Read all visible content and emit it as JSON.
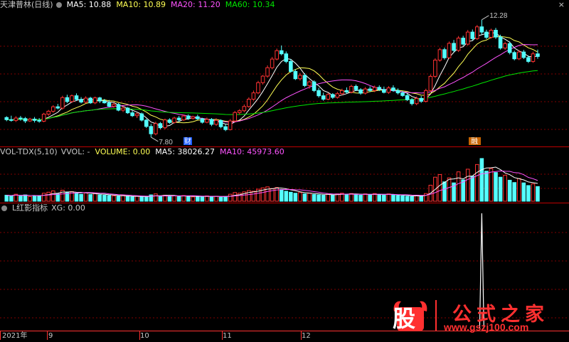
{
  "price_header": {
    "stock": "天津普林(日线)",
    "ma5": "MA5: 10.88",
    "ma10": "MA10: 10.89",
    "ma20": "MA20: 11.20",
    "ma60": "MA60: 10.34"
  },
  "volume_header": {
    "name": "VOL-TDX(5,10)",
    "vvol": "VVOL: -",
    "volume": "VOLUME: 0.00",
    "ma5": "MA5: 38026.27",
    "ma10": "MA10: 45973.60"
  },
  "indicator_header": {
    "name": "L红影指标",
    "xg": "XG: 0.00"
  },
  "annotations": {
    "high": "12.28",
    "low": "7.80",
    "tag_cai": "财",
    "tag_rong": "融"
  },
  "time_axis": [
    "2021年",
    "9",
    "10",
    "11",
    "12"
  ],
  "close_glyph": "×",
  "watermark": {
    "badge": "股",
    "title": "公式之家",
    "url": "www.gszj100.com"
  },
  "colors": {
    "up": "#ff3232",
    "down": "#54ffff",
    "ma5": "#ffffff",
    "ma10": "#ffff54",
    "ma20": "#ff54ff",
    "ma60": "#00e600",
    "grid": "#800000",
    "axis": "#ff3232"
  },
  "chart_data": [
    {
      "type": "candlestick",
      "title": "天津普林(日线)",
      "ylim": [
        7.5,
        12.6
      ],
      "series_names": [
        "MA5",
        "MA10",
        "MA20",
        "MA60"
      ],
      "ohlc": [
        [
          8.55,
          8.6,
          8.41,
          8.47
        ],
        [
          8.47,
          8.62,
          8.39,
          8.44
        ],
        [
          8.44,
          8.6,
          8.38,
          8.53
        ],
        [
          8.53,
          8.61,
          8.43,
          8.51
        ],
        [
          8.51,
          8.57,
          8.34,
          8.42
        ],
        [
          8.42,
          8.54,
          8.38,
          8.49
        ],
        [
          8.49,
          8.57,
          8.36,
          8.44
        ],
        [
          8.44,
          8.53,
          8.35,
          8.41
        ],
        [
          8.41,
          8.73,
          8.37,
          8.68
        ],
        [
          8.68,
          8.84,
          8.61,
          8.79
        ],
        [
          8.79,
          9.02,
          8.73,
          8.96
        ],
        [
          8.96,
          9.07,
          8.86,
          8.91
        ],
        [
          8.91,
          9.38,
          8.85,
          9.31
        ],
        [
          9.31,
          9.42,
          9.1,
          9.16
        ],
        [
          9.16,
          9.43,
          9.11,
          9.38
        ],
        [
          9.38,
          9.47,
          9.18,
          9.24
        ],
        [
          9.24,
          9.33,
          9.09,
          9.14
        ],
        [
          9.14,
          9.36,
          9.09,
          9.29
        ],
        [
          9.29,
          9.34,
          9.07,
          9.11
        ],
        [
          9.11,
          9.35,
          9.06,
          9.3
        ],
        [
          9.3,
          9.34,
          9.1,
          9.18
        ],
        [
          9.18,
          9.26,
          9.08,
          9.11
        ],
        [
          9.11,
          9.22,
          8.94,
          8.98
        ],
        [
          8.98,
          9.11,
          8.92,
          9.05
        ],
        [
          9.05,
          9.1,
          8.79,
          8.83
        ],
        [
          8.83,
          8.98,
          8.76,
          8.91
        ],
        [
          8.91,
          8.95,
          8.69,
          8.73
        ],
        [
          8.73,
          8.81,
          8.57,
          8.62
        ],
        [
          8.62,
          8.74,
          8.53,
          8.69
        ],
        [
          8.69,
          8.74,
          8.4,
          8.45
        ],
        [
          8.45,
          8.5,
          8.15,
          8.21
        ],
        [
          8.21,
          8.31,
          7.8,
          7.93
        ],
        [
          7.93,
          8.39,
          7.87,
          8.32
        ],
        [
          8.32,
          8.38,
          8.1,
          8.16
        ],
        [
          8.16,
          8.51,
          8.1,
          8.46
        ],
        [
          8.46,
          8.52,
          8.31,
          8.36
        ],
        [
          8.36,
          8.58,
          8.32,
          8.53
        ],
        [
          8.53,
          8.61,
          8.39,
          8.46
        ],
        [
          8.46,
          8.66,
          8.42,
          8.61
        ],
        [
          8.61,
          8.67,
          8.46,
          8.52
        ],
        [
          8.52,
          8.62,
          8.47,
          8.58
        ],
        [
          8.58,
          8.66,
          8.46,
          8.5
        ],
        [
          8.5,
          8.54,
          8.32,
          8.37
        ],
        [
          8.37,
          8.55,
          8.33,
          8.48
        ],
        [
          8.48,
          8.53,
          8.22,
          8.29
        ],
        [
          8.29,
          8.52,
          8.23,
          8.44
        ],
        [
          8.44,
          8.48,
          8.14,
          8.2
        ],
        [
          8.2,
          8.3,
          8.03,
          8.09
        ],
        [
          8.09,
          8.49,
          8.06,
          8.42
        ],
        [
          8.42,
          8.8,
          8.37,
          8.74
        ],
        [
          8.74,
          8.87,
          8.67,
          8.81
        ],
        [
          8.81,
          9.05,
          8.75,
          8.97
        ],
        [
          8.97,
          9.32,
          8.92,
          9.25
        ],
        [
          9.25,
          9.58,
          9.19,
          9.49
        ],
        [
          9.49,
          9.95,
          9.44,
          9.88
        ],
        [
          9.88,
          10.17,
          9.81,
          10.13
        ],
        [
          10.13,
          10.54,
          10.07,
          10.45
        ],
        [
          10.45,
          10.86,
          10.39,
          10.78
        ],
        [
          10.78,
          11.18,
          10.73,
          11.1
        ],
        [
          11.1,
          11.3,
          10.92,
          10.98
        ],
        [
          10.98,
          11.07,
          10.62,
          10.69
        ],
        [
          10.69,
          10.78,
          10.26,
          10.31
        ],
        [
          10.31,
          10.39,
          9.98,
          10.03
        ],
        [
          10.03,
          10.25,
          9.96,
          10.16
        ],
        [
          10.16,
          10.24,
          9.71,
          9.77
        ],
        [
          9.77,
          9.97,
          9.65,
          9.91
        ],
        [
          9.91,
          9.97,
          9.52,
          9.58
        ],
        [
          9.58,
          9.68,
          9.31,
          9.38
        ],
        [
          9.38,
          9.5,
          9.19,
          9.25
        ],
        [
          9.25,
          9.49,
          9.21,
          9.43
        ],
        [
          9.43,
          9.48,
          9.26,
          9.32
        ],
        [
          9.32,
          9.53,
          9.27,
          9.46
        ],
        [
          9.46,
          9.65,
          9.4,
          9.58
        ],
        [
          9.58,
          9.7,
          9.47,
          9.52
        ],
        [
          9.52,
          9.8,
          9.47,
          9.74
        ],
        [
          9.74,
          9.81,
          9.56,
          9.61
        ],
        [
          9.61,
          9.67,
          9.42,
          9.48
        ],
        [
          9.48,
          9.71,
          9.43,
          9.64
        ],
        [
          9.64,
          9.74,
          9.52,
          9.58
        ],
        [
          9.58,
          9.77,
          9.52,
          9.7
        ],
        [
          9.7,
          9.78,
          9.56,
          9.62
        ],
        [
          9.62,
          9.73,
          9.47,
          9.51
        ],
        [
          9.51,
          9.75,
          9.45,
          9.68
        ],
        [
          9.68,
          9.78,
          9.53,
          9.58
        ],
        [
          9.58,
          9.66,
          9.43,
          9.49
        ],
        [
          9.49,
          9.56,
          9.34,
          9.39
        ],
        [
          9.39,
          9.46,
          9.18,
          9.23
        ],
        [
          9.23,
          9.29,
          9.01,
          9.08
        ],
        [
          9.08,
          9.35,
          9.02,
          9.28
        ],
        [
          9.28,
          9.37,
          9.11,
          9.17
        ],
        [
          9.17,
          9.65,
          9.12,
          9.58
        ],
        [
          9.58,
          10.19,
          9.52,
          10.12
        ],
        [
          10.12,
          10.81,
          10.06,
          10.74
        ],
        [
          10.74,
          11.21,
          10.68,
          11.14
        ],
        [
          11.14,
          11.22,
          10.76,
          10.83
        ],
        [
          10.83,
          11.45,
          10.79,
          11.38
        ],
        [
          11.38,
          11.51,
          11.04,
          11.11
        ],
        [
          11.11,
          11.66,
          11.05,
          11.58
        ],
        [
          11.58,
          11.67,
          11.29,
          11.35
        ],
        [
          11.35,
          11.89,
          11.29,
          11.81
        ],
        [
          11.81,
          11.91,
          11.49,
          11.56
        ],
        [
          11.56,
          12.08,
          11.51,
          12.01
        ],
        [
          12.01,
          12.28,
          11.72,
          11.81
        ],
        [
          11.81,
          11.9,
          11.54,
          11.61
        ],
        [
          11.61,
          11.94,
          11.56,
          11.88
        ],
        [
          11.88,
          11.97,
          11.55,
          11.62
        ],
        [
          11.62,
          11.71,
          11.14,
          11.2
        ],
        [
          11.2,
          11.44,
          11.13,
          11.37
        ],
        [
          11.37,
          11.45,
          10.96,
          11.03
        ],
        [
          11.03,
          11.1,
          10.73,
          10.79
        ],
        [
          10.79,
          11.12,
          10.74,
          11.05
        ],
        [
          11.05,
          11.13,
          10.78,
          10.84
        ],
        [
          10.84,
          10.92,
          10.63,
          10.69
        ],
        [
          10.69,
          11.06,
          10.64,
          10.98
        ],
        [
          10.98,
          11.14,
          10.79,
          10.88
        ]
      ]
    },
    {
      "type": "bar",
      "title": "VOL-TDX(5,10)",
      "ylim": [
        0,
        130000
      ],
      "values": [
        18000,
        16000,
        21000,
        15000,
        19000,
        14000,
        17000,
        16000,
        24000,
        27000,
        31000,
        22000,
        33000,
        26000,
        29000,
        24000,
        21000,
        25000,
        20000,
        23000,
        19000,
        18000,
        17000,
        16000,
        15000,
        17000,
        14000,
        13000,
        15000,
        14000,
        12000,
        19000,
        22000,
        16000,
        18000,
        14000,
        16000,
        15000,
        17000,
        14000,
        13000,
        15000,
        14000,
        16000,
        13000,
        15000,
        12000,
        14000,
        21000,
        26000,
        24000,
        28000,
        32000,
        30000,
        36000,
        40000,
        43000,
        38000,
        41000,
        35000,
        30000,
        27000,
        24000,
        26000,
        22000,
        24000,
        20000,
        19000,
        18000,
        21000,
        19000,
        22000,
        24000,
        21000,
        23000,
        20000,
        18000,
        22000,
        19000,
        23000,
        20000,
        18000,
        22000,
        19000,
        17000,
        16000,
        15000,
        14000,
        18000,
        16000,
        23000,
        48000,
        72000,
        80000,
        58000,
        70000,
        55000,
        88000,
        64000,
        96000,
        75000,
        110000,
        128000,
        90000,
        98000,
        86000,
        72000,
        78000,
        63000,
        56000,
        68000,
        55000,
        47000,
        52000,
        44000
      ]
    },
    {
      "type": "line",
      "title": "L红影指标",
      "series_names": [
        "XG"
      ],
      "ylim": [
        0,
        1
      ],
      "spike_index": 102,
      "values_note_free": true
    }
  ]
}
